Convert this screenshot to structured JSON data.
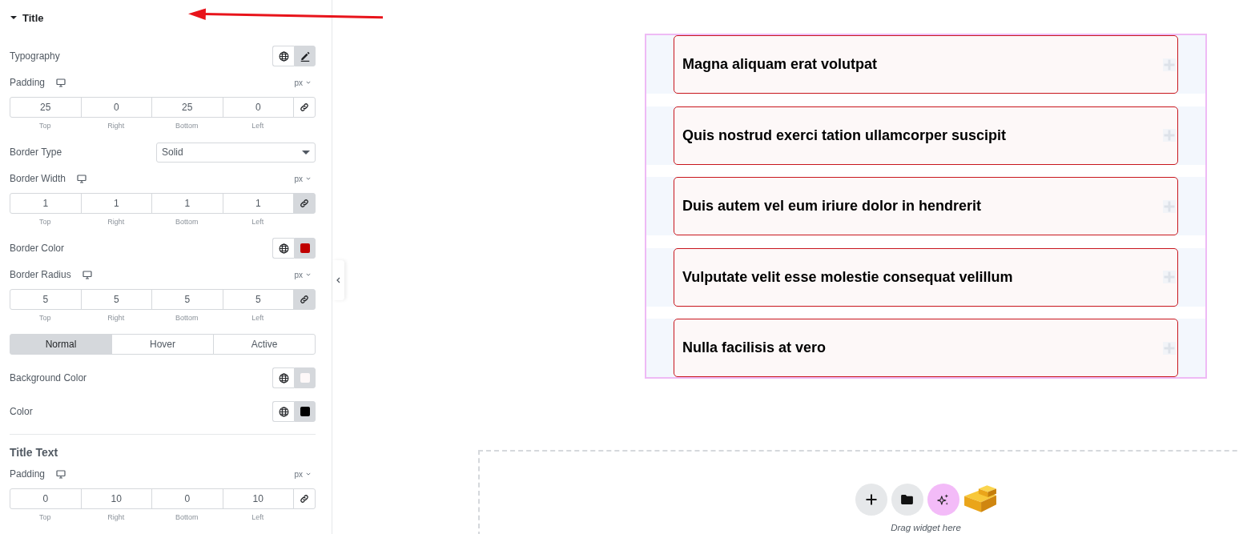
{
  "panel": {
    "section": {
      "title": "Title",
      "expanded": true
    },
    "controls": [
      {
        "kind": "popover",
        "label": "Typography"
      },
      {
        "kind": "dimensions",
        "label": "Padding",
        "responsive": true,
        "unit": "px",
        "linked": false,
        "sides": [
          {
            "value": "25",
            "label": "Top"
          },
          {
            "value": "0",
            "label": "Right"
          },
          {
            "value": "25",
            "label": "Bottom"
          },
          {
            "value": "0",
            "label": "Left"
          }
        ]
      },
      {
        "kind": "select",
        "label": "Border Type",
        "value": "Solid"
      },
      {
        "kind": "dimensions",
        "label": "Border Width",
        "responsive": true,
        "unit": "px",
        "linked": true,
        "sides": [
          {
            "value": "1",
            "label": "Top"
          },
          {
            "value": "1",
            "label": "Right"
          },
          {
            "value": "1",
            "label": "Bottom"
          },
          {
            "value": "1",
            "label": "Left"
          }
        ]
      },
      {
        "kind": "color",
        "label": "Border Color",
        "color": "#c00000"
      },
      {
        "kind": "dimensions",
        "label": "Border Radius",
        "responsive": true,
        "unit": "px",
        "linked": true,
        "sides": [
          {
            "value": "5",
            "label": "Top"
          },
          {
            "value": "5",
            "label": "Right"
          },
          {
            "value": "5",
            "label": "Bottom"
          },
          {
            "value": "5",
            "label": "Left"
          }
        ]
      },
      {
        "kind": "tabs",
        "tabs": [
          {
            "label": "Normal",
            "selected": true
          },
          {
            "label": "Hover",
            "selected": false
          },
          {
            "label": "Active",
            "selected": false
          }
        ]
      },
      {
        "kind": "color",
        "label": "Background Color",
        "color": "#fdf8f8"
      },
      {
        "kind": "color",
        "label": "Color",
        "color": "#000000"
      },
      {
        "kind": "heading",
        "label": "Title Text"
      },
      {
        "kind": "dimensions",
        "label": "Padding",
        "responsive": true,
        "unit": "px",
        "linked": false,
        "sides": [
          {
            "value": "0",
            "label": "Top"
          },
          {
            "value": "10",
            "label": "Right"
          },
          {
            "value": "0",
            "label": "Bottom"
          },
          {
            "value": "10",
            "label": "Left"
          }
        ]
      }
    ]
  },
  "accordion": {
    "items": [
      {
        "title": "Magna aliquam erat volutpat",
        "expanded": false
      },
      {
        "title": "Quis nostrud exerci tation ullamcorper suscipit",
        "expanded": false
      },
      {
        "title": "Duis autem vel eum iriure dolor in hendrerit",
        "expanded": false
      },
      {
        "title": "Vulputate velit esse molestie consequat velillum",
        "expanded": false
      },
      {
        "title": "Nulla facilisis at vero",
        "expanded": false
      }
    ]
  },
  "drop_zone": {
    "hint": "Drag widget here"
  }
}
